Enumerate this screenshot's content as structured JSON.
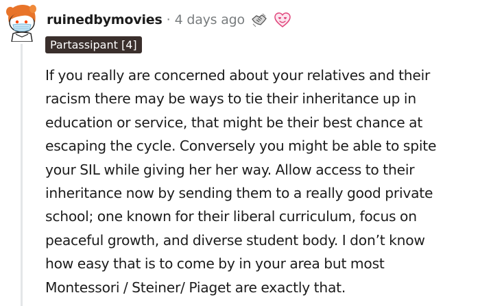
{
  "comment": {
    "author": "ruinedbymovies",
    "separator": "·",
    "timestamp": "4 days ago",
    "flair": "Partassipant [4]",
    "awards": [
      "handshake-award-icon",
      "heart-eyes-award-icon"
    ],
    "body_lines": [
      "If you really are concerned about your relatives and their",
      "racism there may be ways to tie their inheritance up in",
      "education or service, that might be their best chance at",
      "escaping the cycle. Conversely you might be able to spite",
      "your SIL while giving her her way. Allow access to their",
      "inheritance now by sending them to a really good private",
      "school; one known for their liberal curriculum, focus on",
      "peaceful growth, and diverse student body. I don’t know",
      "how easy that is to come by in your area but most",
      "Montessori / Steiner/ Piaget are exactly that."
    ]
  },
  "colors": {
    "flair_bg": "#3a2f2c",
    "meta_text": "#787c7e",
    "body_text": "#1c1c1c",
    "thread_line": "#e4e6e8"
  }
}
